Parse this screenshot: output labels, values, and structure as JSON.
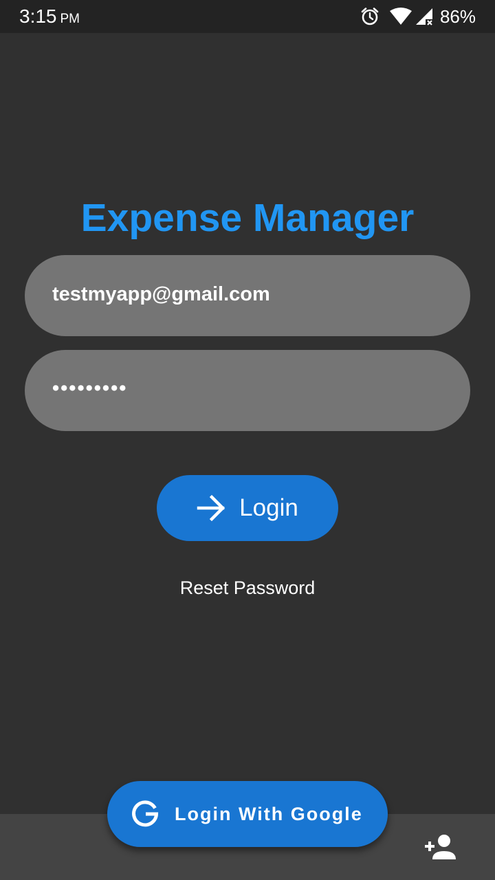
{
  "status_bar": {
    "time": "3:15",
    "ampm": "PM",
    "battery": "86%",
    "icons": [
      "alarm-icon",
      "wifi-icon",
      "signal-icon"
    ]
  },
  "app": {
    "title": "Expense Manager",
    "accent_color": "#2196f3",
    "button_color": "#1976d2"
  },
  "login_form": {
    "email_value": "testmyapp@gmail.com",
    "password_value": "•••••••••"
  },
  "actions": {
    "login_label": "Login",
    "login_icon": "arrow-forward-icon",
    "reset_label": "Reset Password",
    "google_label": "Login With Google",
    "google_icon": "google-g-icon",
    "signup_icon": "person-add-icon"
  }
}
